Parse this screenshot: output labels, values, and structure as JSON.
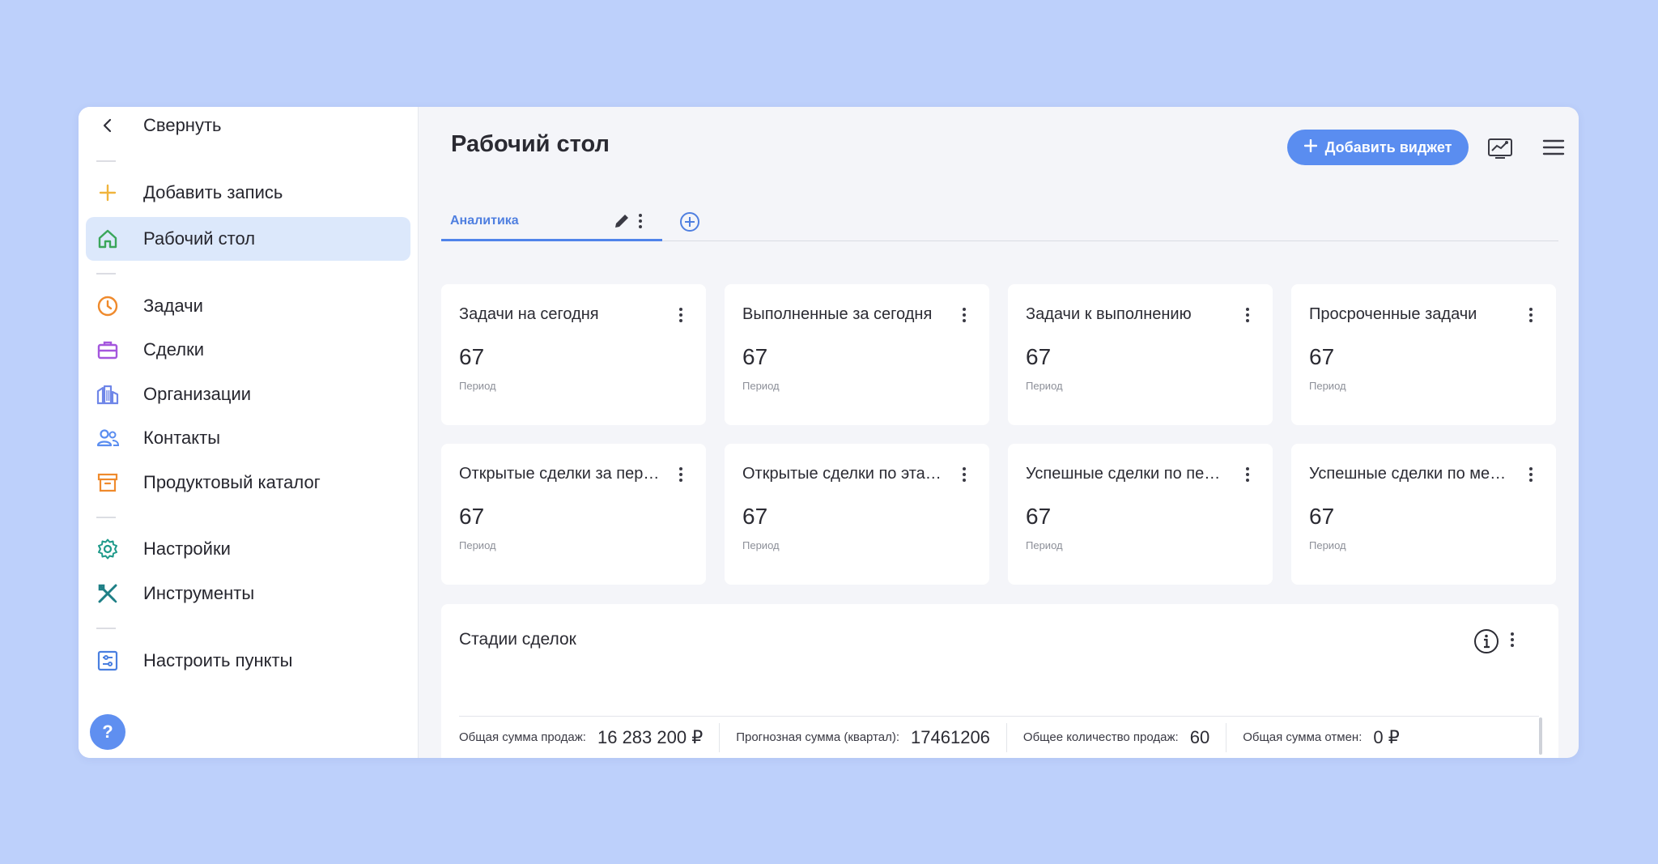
{
  "sidebar": {
    "collapse_label": "Свернуть",
    "add_record_label": "Добавить запись",
    "items": [
      {
        "label": "Рабочий стол",
        "icon": "home-icon",
        "active": true
      },
      {
        "label": "Задачи",
        "icon": "clock-icon"
      },
      {
        "label": "Сделки",
        "icon": "briefcase-icon"
      },
      {
        "label": "Организации",
        "icon": "buildings-icon"
      },
      {
        "label": "Контакты",
        "icon": "people-icon"
      },
      {
        "label": "Продуктовый каталог",
        "icon": "archive-icon"
      },
      {
        "label": "Настройки",
        "icon": "gear-icon"
      },
      {
        "label": "Инструменты",
        "icon": "tools-icon"
      },
      {
        "label": "Настроить пункты",
        "icon": "sliders-icon"
      }
    ],
    "help_label": "?"
  },
  "header": {
    "title": "Рабочий стол",
    "add_widget_label": "Добавить виджет"
  },
  "tabs": [
    {
      "label": "Аналитика",
      "active": true
    }
  ],
  "cards": [
    {
      "title": "Задачи на сегодня",
      "value": "67",
      "sub": "Период"
    },
    {
      "title": "Выполненные за сегодня",
      "value": "67",
      "sub": "Период"
    },
    {
      "title": "Задачи к выполнению",
      "value": "67",
      "sub": "Период"
    },
    {
      "title": "Просроченные задачи",
      "value": "67",
      "sub": "Период"
    },
    {
      "title": "Открытые сделки за период",
      "value": "67",
      "sub": "Период"
    },
    {
      "title": "Открытые сделки по этапам",
      "value": "67",
      "sub": "Период"
    },
    {
      "title": "Успешные сделки по периоду",
      "value": "67",
      "sub": "Период"
    },
    {
      "title": "Успешные сделки по менеджерам",
      "value": "67",
      "sub": "Период"
    }
  ],
  "stages": {
    "title": "Стадии сделок",
    "stats": [
      {
        "label": "Общая сумма продаж:",
        "value": "16 283 200 ₽"
      },
      {
        "label": "Прогнозная сумма (квартал):",
        "value": "17461206"
      },
      {
        "label": "Общее количество продаж:",
        "value": "60"
      },
      {
        "label": "Общая сумма отмен:",
        "value": "0 ₽"
      }
    ]
  },
  "colors": {
    "background": "#bdd0fb",
    "accent": "#5a8df0",
    "active_item": "#dce8fb"
  }
}
